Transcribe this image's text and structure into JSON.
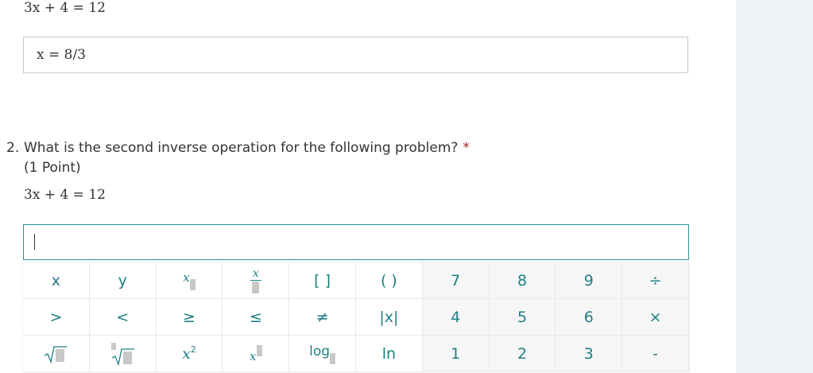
{
  "previous_question": {
    "equation": "3x + 4 = 12",
    "answer": "x = 8/3"
  },
  "question": {
    "number": "2.",
    "text": "What is the second inverse operation for the following problem?",
    "required_mark": "*",
    "points": "(1 Point)",
    "equation": "3x + 4 = 12",
    "input_value": ""
  },
  "keypad": {
    "row1": [
      "x",
      "y",
      "x▯",
      "x/▯",
      "[ ]",
      "( )",
      "7",
      "8",
      "9",
      "÷"
    ],
    "row2": [
      ">",
      "<",
      "≥",
      "≤",
      "≠",
      "|x|",
      "4",
      "5",
      "6",
      "×"
    ],
    "row3": [
      "√▯",
      "▯√▯",
      "x²",
      "x▯",
      "log▯",
      "ln",
      "1",
      "2",
      "3",
      "-"
    ],
    "labels": {
      "x": "x",
      "y": "y",
      "bracket": "[ ]",
      "paren": "( )",
      "gt": ">",
      "lt": "<",
      "ge": "≥",
      "le": "≤",
      "ne": "≠",
      "abs": "|x|",
      "log": "log",
      "ln": "ln",
      "div": "÷",
      "times": "×",
      "minus": "-",
      "n7": "7",
      "n8": "8",
      "n9": "9",
      "n4": "4",
      "n5": "5",
      "n6": "6",
      "n1": "1",
      "n2": "2",
      "n3": "3",
      "x_var": "x",
      "sq": "2"
    }
  }
}
